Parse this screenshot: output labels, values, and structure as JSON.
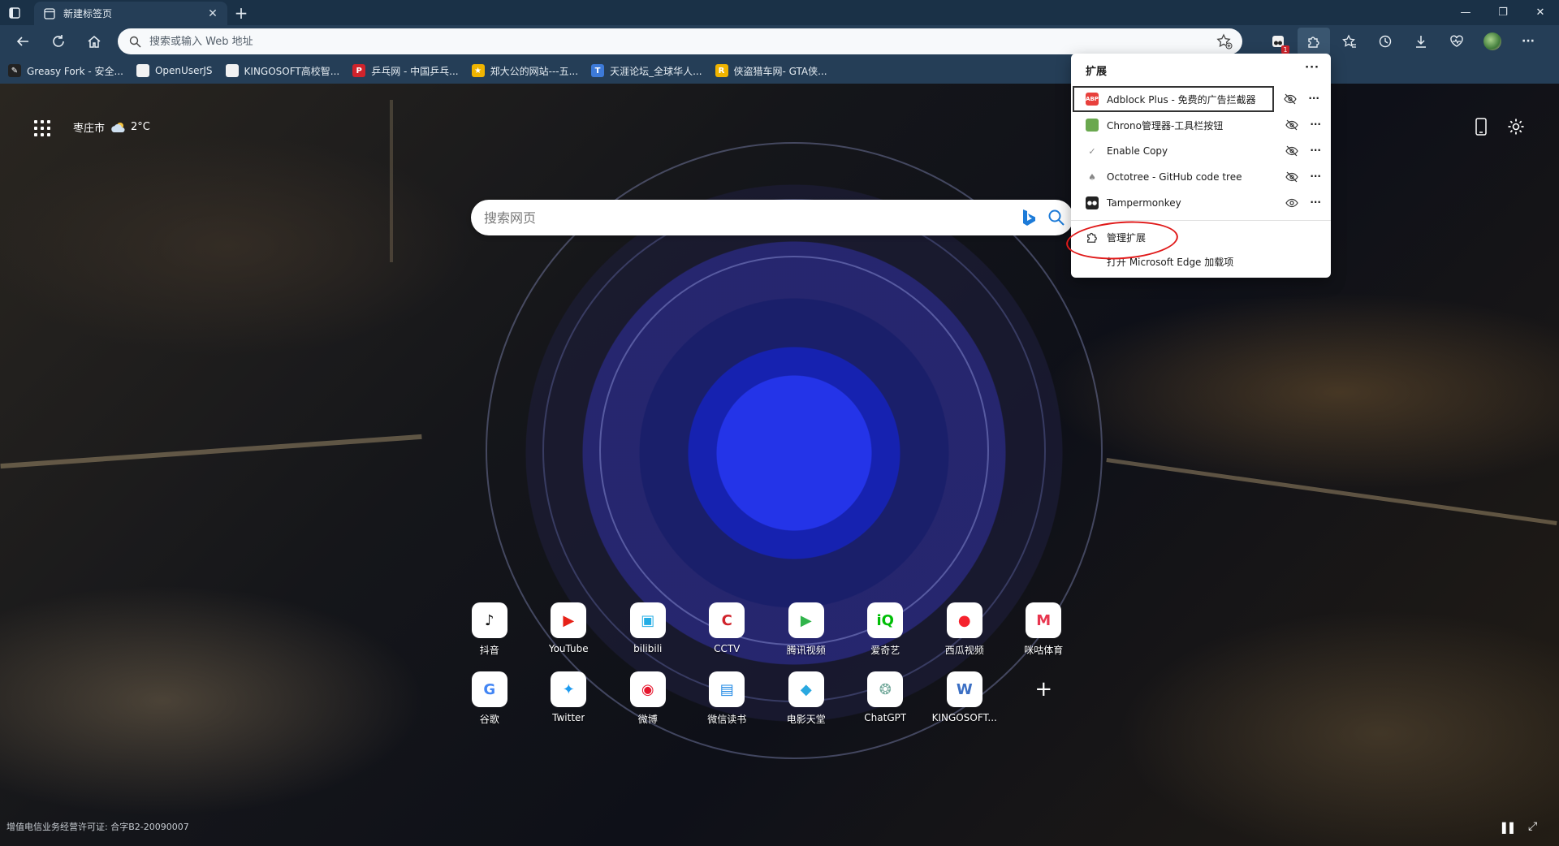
{
  "browser": {
    "tab": {
      "title": "新建标签页"
    },
    "window_controls": {
      "minimize": "—",
      "restore": "❐",
      "close": "✕"
    },
    "address": {
      "placeholder": "搜索或输入 Web 地址",
      "value": ""
    }
  },
  "favorites": [
    {
      "label": "Greasy Fork - 安全...",
      "color": "#222222",
      "glyph": "✎"
    },
    {
      "label": "OpenUserJS",
      "color": "#f2f2f2",
      "glyph": ""
    },
    {
      "label": "KINGOSOFT高校智...",
      "color": "#f2f2f2",
      "glyph": ""
    },
    {
      "label": "乒乓网 - 中国乒乓...",
      "color": "#d0232b",
      "glyph": "P"
    },
    {
      "label": "郑大公的网站---五...",
      "color": "#f0b400",
      "glyph": "★"
    },
    {
      "label": "天涯论坛_全球华人...",
      "color": "#3d7ad8",
      "glyph": "T"
    },
    {
      "label": "侠盗猎车网- GTA侠...",
      "color": "#f0b400",
      "glyph": "R"
    }
  ],
  "ntp": {
    "location": "枣庄市",
    "temperature": "2°C",
    "search_placeholder": "搜索网页",
    "footer_license": "增值电信业务经营许可证: 合字B2-20090007",
    "tiles_row1": [
      {
        "label": "抖音",
        "glyph": "♪",
        "color": "#111111"
      },
      {
        "label": "YouTube",
        "glyph": "▶",
        "color": "#e62117"
      },
      {
        "label": "bilibili",
        "glyph": "▣",
        "color": "#23ade5"
      },
      {
        "label": "CCTV",
        "glyph": "C",
        "color": "#d0232b"
      },
      {
        "label": "腾讯视频",
        "glyph": "▶",
        "color": "#31b44b"
      },
      {
        "label": "爱奇艺",
        "glyph": "iQ",
        "color": "#00be06"
      },
      {
        "label": "西瓜视频",
        "glyph": "●",
        "color": "#f5222d"
      },
      {
        "label": "咪咕体育",
        "glyph": "M",
        "color": "#e8364f"
      }
    ],
    "tiles_row2": [
      {
        "label": "谷歌",
        "glyph": "G",
        "color": "#4285f4"
      },
      {
        "label": "Twitter",
        "glyph": "✦",
        "color": "#1d9bf0"
      },
      {
        "label": "微博",
        "glyph": "◉",
        "color": "#e6162d"
      },
      {
        "label": "微信读书",
        "glyph": "▤",
        "color": "#1e88e5"
      },
      {
        "label": "电影天堂",
        "glyph": "◆",
        "color": "#2aa8e0"
      },
      {
        "label": "ChatGPT",
        "glyph": "❂",
        "color": "#74aa9c"
      },
      {
        "label": "KINGOSOFT...",
        "glyph": "W",
        "color": "#3b6fc4"
      }
    ],
    "add_tile": "+"
  },
  "extensions_popup": {
    "title": "扩展",
    "more": "···",
    "items": [
      {
        "label": "Adblock Plus - 免费的广告拦截器",
        "glyph": "ABP",
        "color": "#e8403c",
        "visible": false
      },
      {
        "label": "Chrono管理器-工具栏按钮",
        "glyph": "",
        "color": "#6aa84f",
        "visible": false
      },
      {
        "label": "Enable Copy",
        "glyph": "✓",
        "color": "#ffffff",
        "visible": false
      },
      {
        "label": "Octotree - GitHub code tree",
        "glyph": "♠",
        "color": "#ffffff",
        "visible": false
      },
      {
        "label": "Tampermonkey",
        "glyph": "●●",
        "color": "#222222",
        "visible": true
      }
    ],
    "manage_label": "管理扩展",
    "open_addons_label": "打开 Microsoft Edge 加载项"
  }
}
